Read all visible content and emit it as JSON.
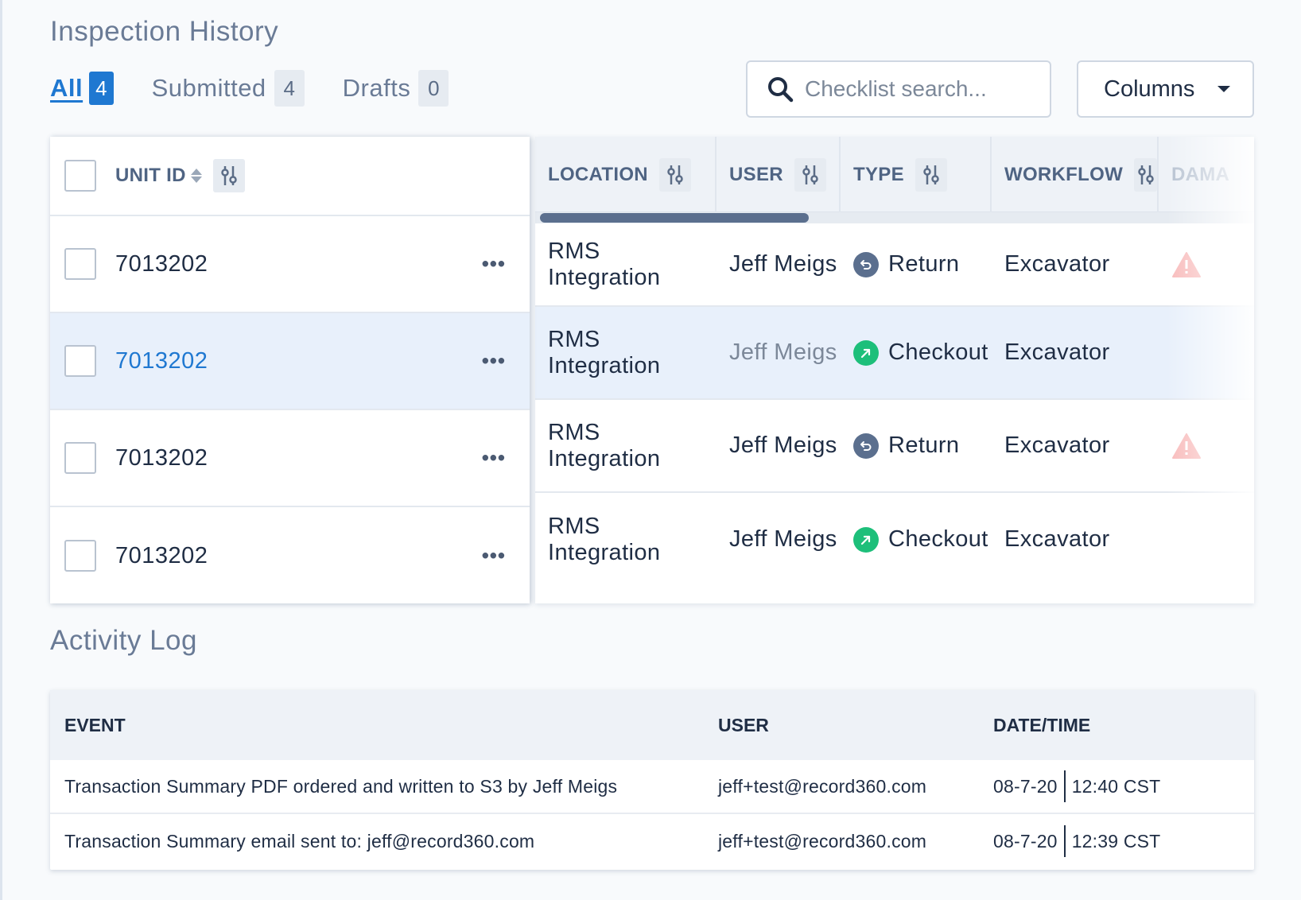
{
  "inspection": {
    "title": "Inspection History",
    "tabs": [
      {
        "label": "All",
        "count": "4"
      },
      {
        "label": "Submitted",
        "count": "4"
      },
      {
        "label": "Drafts",
        "count": "0"
      }
    ],
    "search_placeholder": "Checklist search...",
    "columns_label": "Columns",
    "headers": {
      "unit_id": "UNIT ID",
      "location": "LOCATION",
      "user": "USER",
      "type": "TYPE",
      "workflow": "WORKFLOW",
      "damage": "DAMA"
    },
    "rows": [
      {
        "unit_id": "7013202",
        "location": "RMS Integration",
        "user": "Jeff Meigs",
        "type": "Return",
        "workflow": "Excavator",
        "damage": true
      },
      {
        "unit_id": "7013202",
        "location": "RMS Integration",
        "user": "Jeff Meigs",
        "type": "Checkout",
        "workflow": "Excavator",
        "damage": false
      },
      {
        "unit_id": "7013202",
        "location": "RMS Integration",
        "user": "Jeff Meigs",
        "type": "Return",
        "workflow": "Excavator",
        "damage": true
      },
      {
        "unit_id": "7013202",
        "location": "RMS Integration",
        "user": "Jeff Meigs",
        "type": "Checkout",
        "workflow": "Excavator",
        "damage": false
      }
    ],
    "more_label": "•••"
  },
  "activity": {
    "title": "Activity Log",
    "headers": {
      "event": "EVENT",
      "user": "USER",
      "datetime": "DATE/TIME"
    },
    "rows": [
      {
        "event": "Transaction Summary PDF ordered and written to S3 by Jeff Meigs",
        "user": "jeff+test@record360.com",
        "date": "08-7-20",
        "time": "12:40 CST"
      },
      {
        "event": "Transaction Summary email sent to: jeff@record360.com",
        "user": "jeff+test@record360.com",
        "date": "08-7-20",
        "time": "12:39 CST"
      }
    ]
  },
  "colors": {
    "accent": "#1f78d1",
    "return_icon": "#5b6f8e",
    "checkout_icon": "#1dbf7a",
    "warning": "#f06a6a"
  },
  "icons": {
    "search": "search-icon",
    "filter": "filter-sliders-icon",
    "sort": "sort-icon",
    "return": "return-arrow-icon",
    "checkout": "checkout-arrow-icon",
    "damage": "warning-triangle-icon",
    "more": "more-horizontal-icon",
    "dropdown": "chevron-down-icon"
  }
}
